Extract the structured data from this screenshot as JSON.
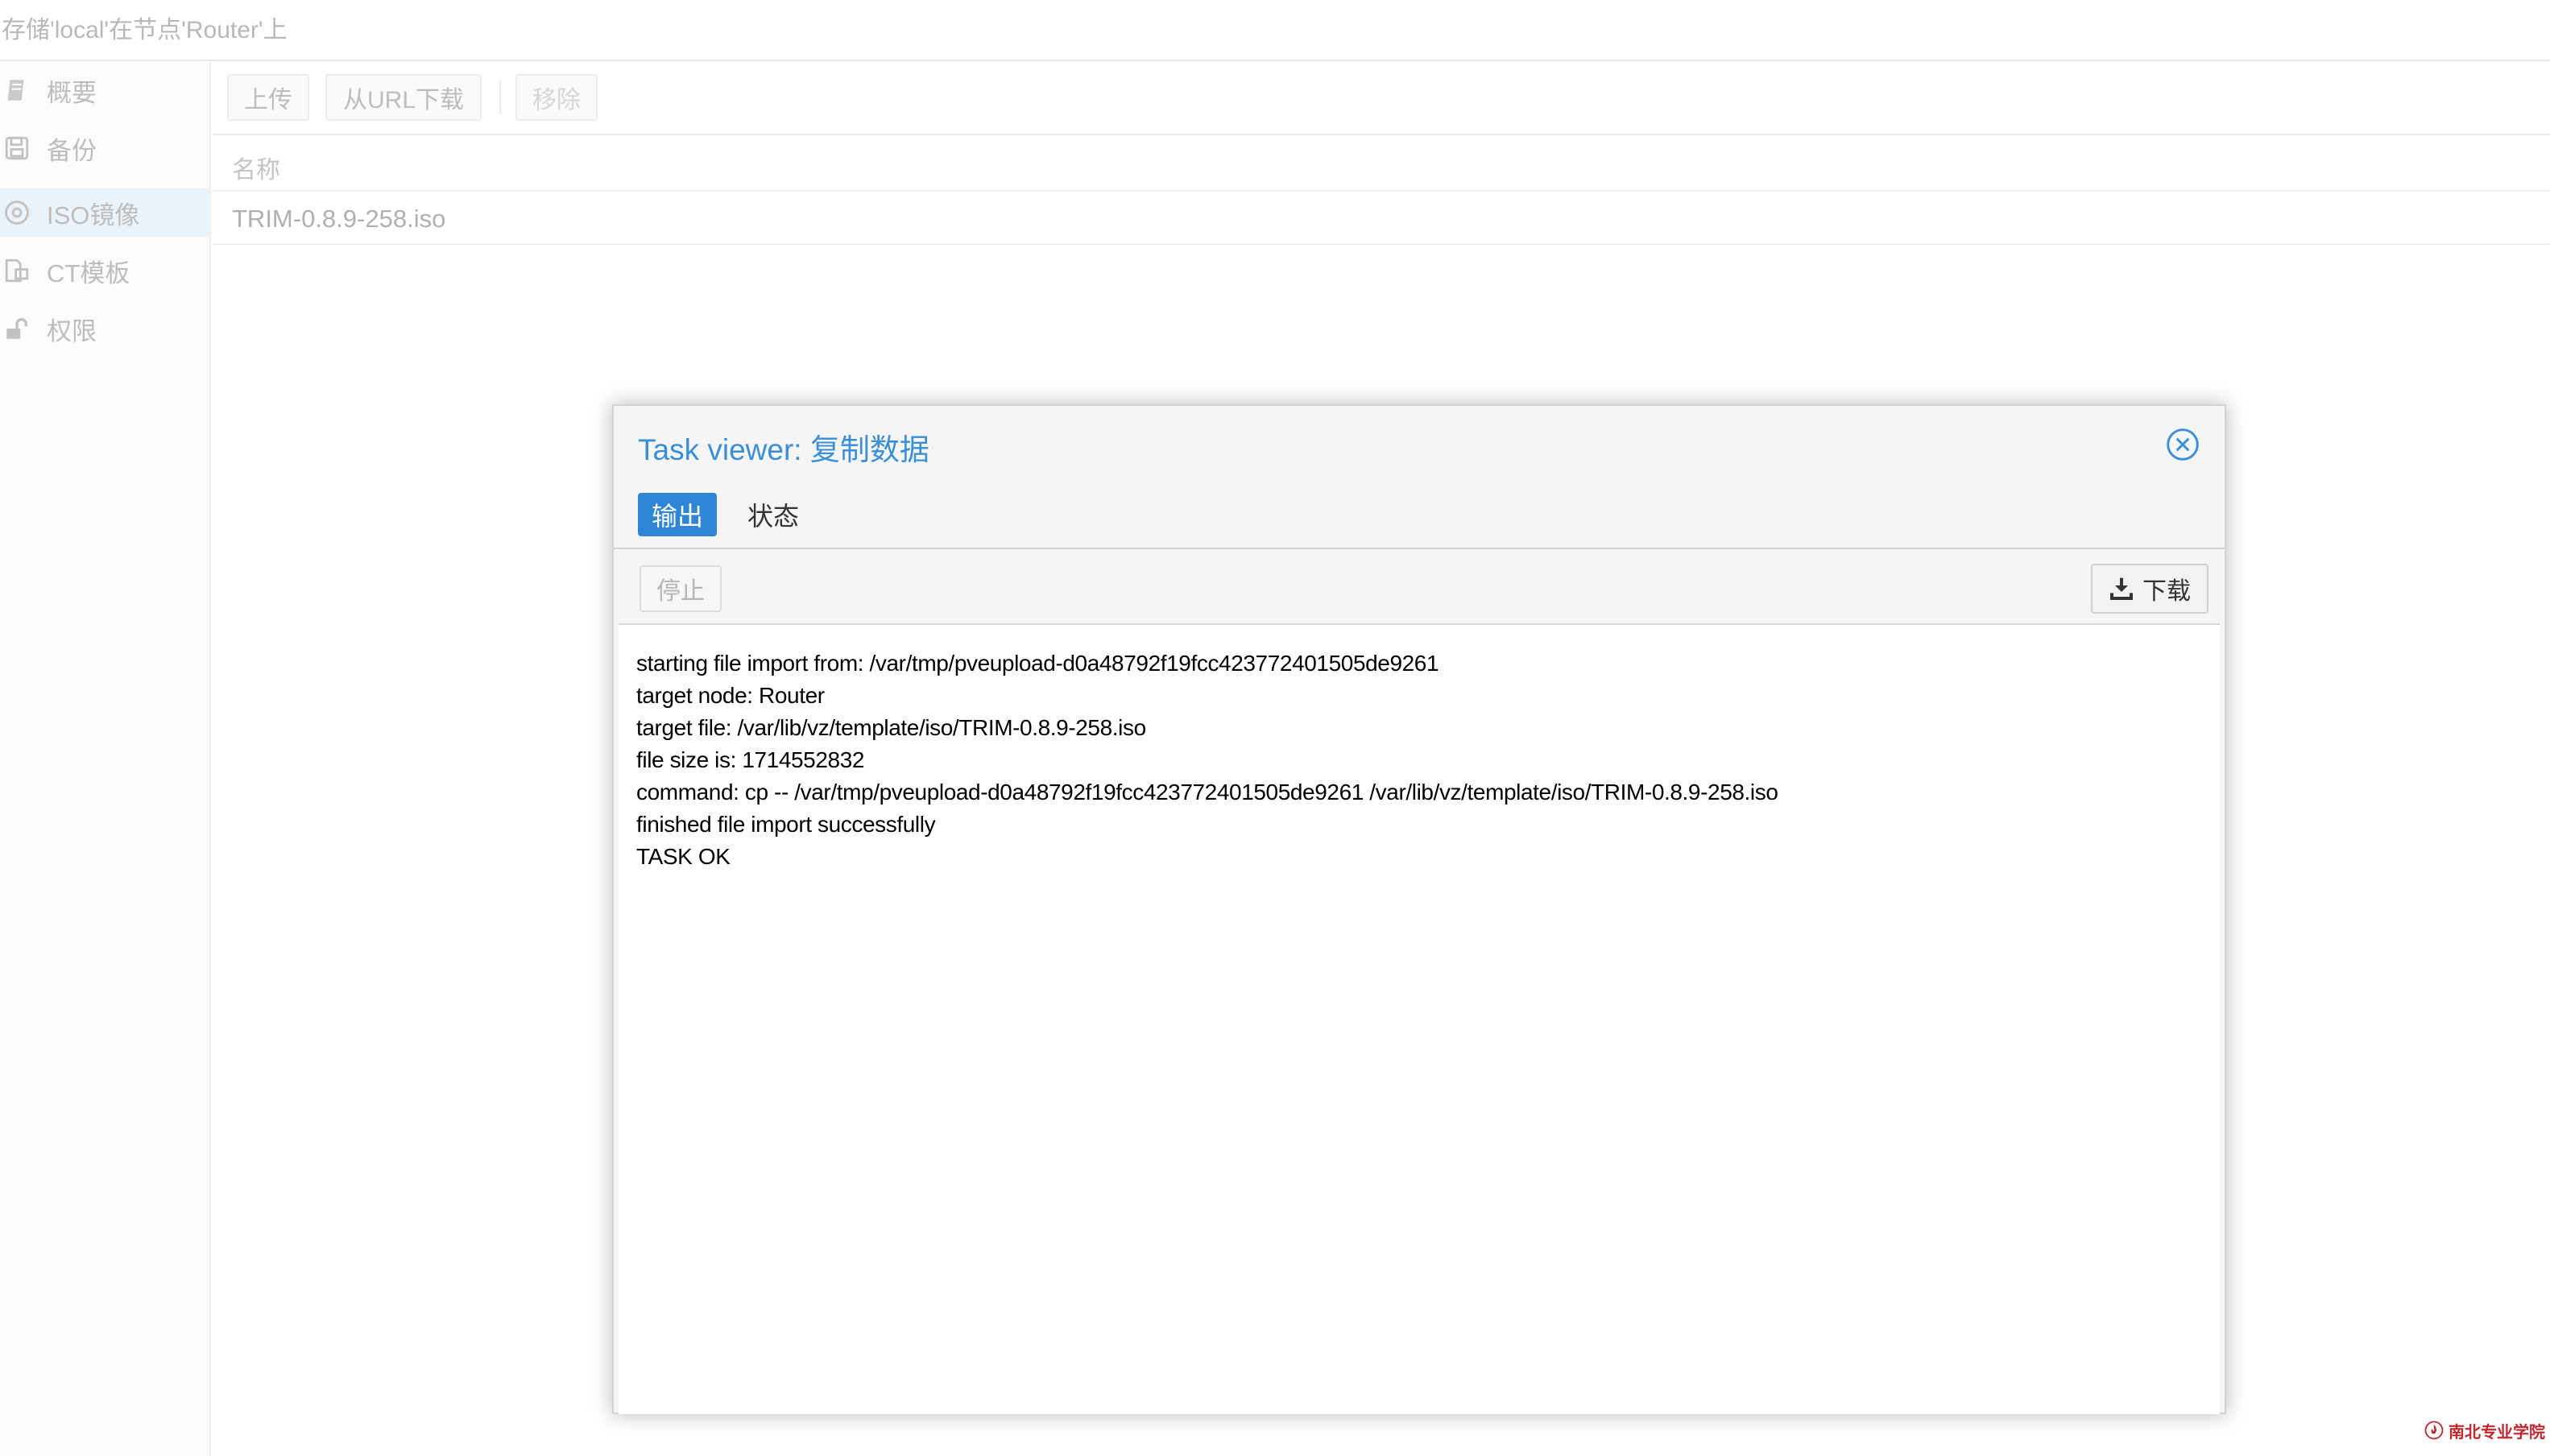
{
  "page": {
    "title": "存储'local'在节点'Router'上"
  },
  "sidebar": {
    "items": [
      {
        "label": "概要",
        "icon": "book-icon"
      },
      {
        "label": "备份",
        "icon": "floppy-disk-icon"
      },
      {
        "label": "ISO镜像",
        "icon": "disc-icon",
        "active": true
      },
      {
        "label": "CT模板",
        "icon": "template-icon"
      },
      {
        "label": "权限",
        "icon": "unlock-icon"
      }
    ]
  },
  "toolbar": {
    "upload_label": "上传",
    "download_url_label": "从URL下载",
    "remove_label": "移除"
  },
  "grid": {
    "header_name": "名称",
    "rows": [
      "TRIM-0.8.9-258.iso"
    ]
  },
  "modal": {
    "title": "Task viewer: 复制数据",
    "tabs": [
      {
        "label": "输出",
        "active": true
      },
      {
        "label": "状态",
        "active": false
      }
    ],
    "stop_label": "停止",
    "download_label": "下载",
    "log_lines": [
      "starting file import from: /var/tmp/pveupload-d0a48792f19fcc423772401505de9261",
      "target node: Router",
      "target file: /var/lib/vz/template/iso/TRIM-0.8.9-258.iso",
      "file size is: 1714552832",
      "command: cp -- /var/tmp/pveupload-d0a48792f19fcc423772401505de9261 /var/lib/vz/template/iso/TRIM-0.8.9-258.iso",
      "finished file import successfully",
      "TASK OK"
    ]
  },
  "watermark": {
    "text": "南北专业学院"
  },
  "colors": {
    "accent": "#2f86d4",
    "title_blue": "#3b8fd6",
    "dimmed_text": "#bdbdbd"
  }
}
